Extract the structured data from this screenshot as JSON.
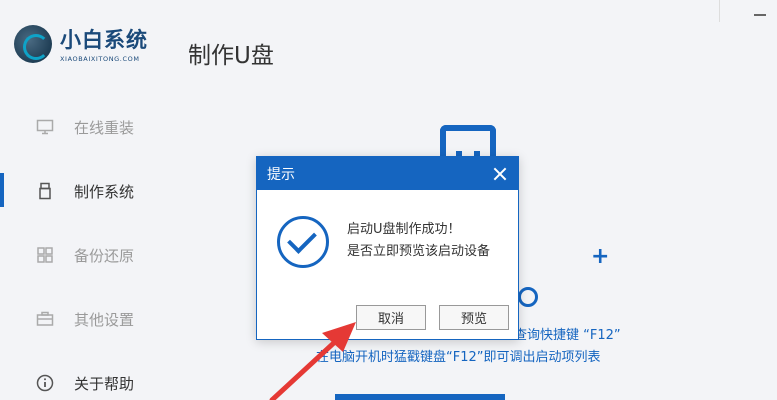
{
  "app": {
    "logo_title": "小白系统",
    "logo_subtitle": "XIAOBAIXITONG.COM"
  },
  "page": {
    "title": "制作U盘"
  },
  "sidebar": {
    "items": [
      {
        "label": "在线重装",
        "icon": "monitor-icon",
        "active": false
      },
      {
        "label": "制作系统",
        "icon": "usb-drive-icon",
        "active": true
      },
      {
        "label": "备份还原",
        "icon": "grid-icon",
        "active": false
      },
      {
        "label": "其他设置",
        "icon": "briefcase-icon",
        "active": false
      },
      {
        "label": "关于帮助",
        "icon": "info-icon",
        "active": false
      }
    ]
  },
  "main": {
    "hint_line1": "查询快捷键 “F12”",
    "hint_line2": "在电脑开机时猛戳键盘“F12”即可调出启动项列表"
  },
  "dialog": {
    "title": "提示",
    "message_line1": "启动U盘制作成功！",
    "message_line2": "是否立即预览该启动设备",
    "cancel_label": "取消",
    "preview_label": "预览"
  },
  "colors": {
    "accent": "#1565c0",
    "arrow": "#e53935"
  }
}
